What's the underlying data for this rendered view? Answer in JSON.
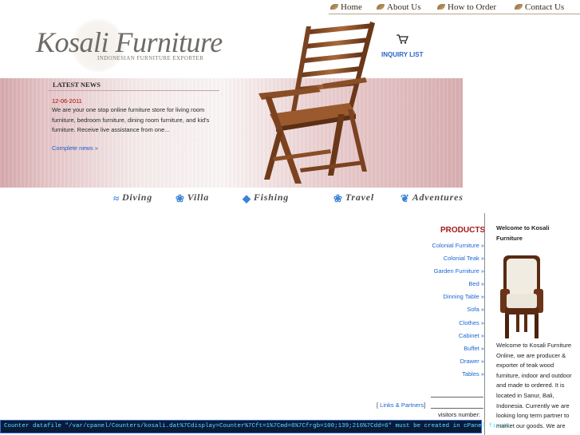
{
  "nav": {
    "items": [
      {
        "label": "Home"
      },
      {
        "label": "About Us"
      },
      {
        "label": "How to Order"
      },
      {
        "label": "Contact Us"
      }
    ]
  },
  "header": {
    "logo": "Kosali Furniture",
    "tagline": "INDONESIAN FURNITURE EXPORTER",
    "inquiry": "INQUIRY LIST"
  },
  "news": {
    "title": "LATEST NEWS",
    "date": "12-06-2011",
    "text": "We are your one stop online furniture store for living room furniture, bedroom furniture, dining room furniture, and kid's furniture. Receive live assistance from one...",
    "more": "Complete news »"
  },
  "categories": [
    {
      "label": "Diving",
      "icon": "fish-icon"
    },
    {
      "label": "Villa",
      "icon": "paw-icon"
    },
    {
      "label": "Fishing",
      "icon": "fish-icon"
    },
    {
      "label": "Travel",
      "icon": "paw-icon"
    },
    {
      "label": "Adventures",
      "icon": "butterfly-icon"
    }
  ],
  "products": {
    "title": "PRODUCTS",
    "items": [
      {
        "label": "Colonial Furniture »"
      },
      {
        "label": "Colonial Teak »"
      },
      {
        "label": "Garden Furniture »"
      },
      {
        "label": "Bed »"
      },
      {
        "label": "Dinning Table »"
      },
      {
        "label": "Sofa »"
      },
      {
        "label": "Clothes »"
      },
      {
        "label": "Cabinet »"
      },
      {
        "label": "Buffet »"
      },
      {
        "label": "Drawer »"
      },
      {
        "label": "Tables »"
      }
    ]
  },
  "footer": {
    "links_open": "[ ",
    "links": "Links & Partners",
    "links_close": "]",
    "visitors": "visitors number:",
    "counter": "Counter datafile \"/var/cpanel/Counters/kosali.dat%7Cdisplay=Counter%7Cft=1%7Cmd=6%7Cfrgb=100;139;216%7Cdd=6\" must be created in cPanel first!"
  },
  "welcome": {
    "title": "Welcome to Kosali Furniture",
    "text": "Welcome to Kosali Furniture Online, we are producer & exporter of teak wood furniture, indoor and outdoor and made to ordered. It is located in Sanur, Bali, Indonesia. Currently we are looking long term partner to market our goods. We are"
  },
  "colors": {
    "accent": "#1a66d4",
    "products_title": "#a51a1a",
    "news_date": "#b40000",
    "counter_text": "#58e1ff"
  }
}
